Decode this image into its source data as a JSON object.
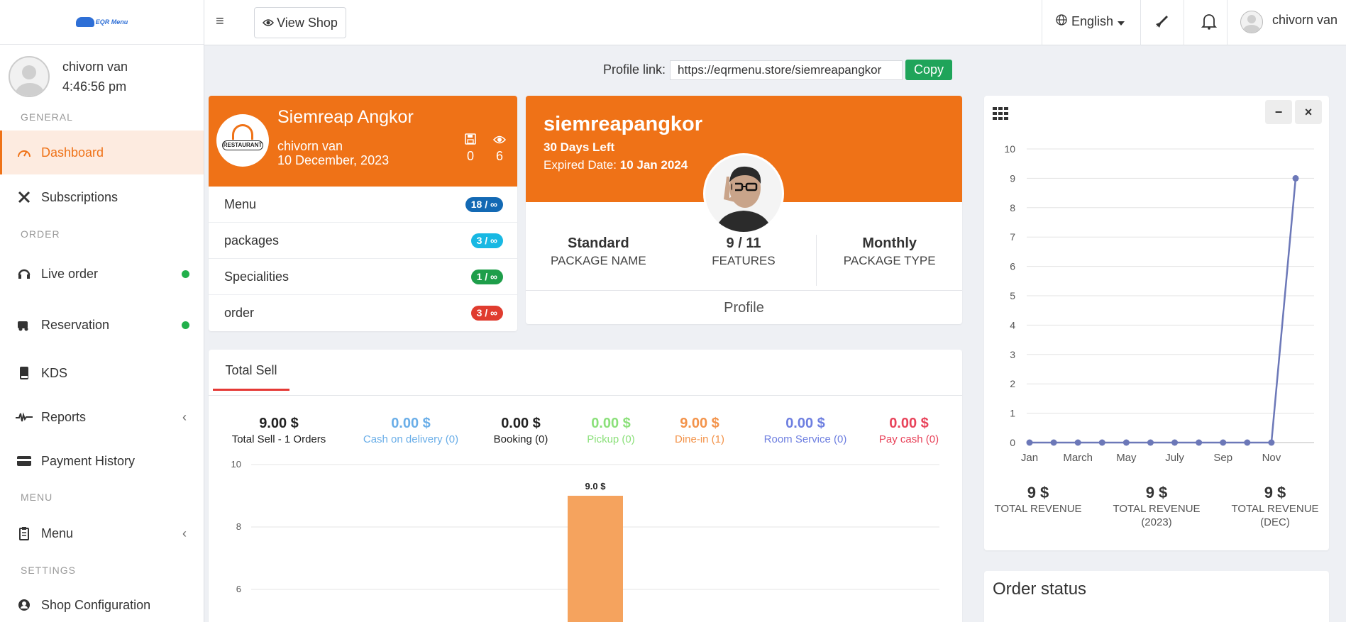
{
  "sidebar": {
    "logo_text": "EQR Menu",
    "user": {
      "name": "chivorn van",
      "time": "4:46:56 pm"
    },
    "sections": {
      "general": "GENERAL",
      "order": "ORDER",
      "menu": "MENU",
      "settings": "SETTINGS"
    },
    "items": {
      "dashboard": "Dashboard",
      "subscriptions": "Subscriptions",
      "live_order": "Live order",
      "reservation": "Reservation",
      "kds": "KDS",
      "reports": "Reports",
      "payment_history": "Payment History",
      "menu": "Menu",
      "shop_configuration": "Shop Configuration"
    },
    "status_color": "#22b04b",
    "accent": "#ef7217"
  },
  "topbar": {
    "view_shop": "View Shop",
    "language": "English",
    "username": "chivorn van"
  },
  "profile_link": {
    "label": "Profile link:",
    "url": "https://eqrmenu.store/siemreapangkor",
    "copy": "Copy"
  },
  "shop_card": {
    "name": "Siemreap Angkor",
    "logo_text": "RESTAURANT",
    "owner": "chivorn van",
    "date": "10 December, 2023",
    "saves": "0",
    "views": "6",
    "counts": [
      {
        "label": "Menu",
        "value": "18 / ∞",
        "color": "#1369b4"
      },
      {
        "label": "packages",
        "value": "3 / ∞",
        "color": "#18b8e3"
      },
      {
        "label": "Specialities",
        "value": "1 / ∞",
        "color": "#1e9e4a"
      },
      {
        "label": "order",
        "value": "3 / ∞",
        "color": "#e03c2f"
      }
    ]
  },
  "package_card": {
    "slug": "siemreapangkor",
    "days_left": "30 Days Left",
    "expired_label": "Expired Date:",
    "expired_date": "10 Jan 2024",
    "package_name": "Standard",
    "package_name_label": "PACKAGE NAME",
    "features": "9 / 11",
    "features_label": "FEATURES",
    "package_type": "Monthly",
    "package_type_label": "PACKAGE TYPE",
    "profile": "Profile"
  },
  "total_sell": {
    "tab": "Total Sell",
    "stats": [
      {
        "value": "9.00 $",
        "label": "Total Sell - 1 Orders",
        "color": "#222222"
      },
      {
        "value": "0.00 $",
        "label": "Cash on delivery (0)",
        "color": "#6aaee8"
      },
      {
        "value": "0.00 $",
        "label": "Booking (0)",
        "color": "#222222"
      },
      {
        "value": "0.00 $",
        "label": "Pickup (0)",
        "color": "#8be07a"
      },
      {
        "value": "9.00 $",
        "label": "Dine-in (1)",
        "color": "#f3934a"
      },
      {
        "value": "0.00 $",
        "label": "Room Service (0)",
        "color": "#6e7fe0"
      },
      {
        "value": "0.00 $",
        "label": "Pay cash (0)",
        "color": "#e8435a"
      }
    ]
  },
  "chart_data": [
    {
      "type": "bar",
      "title": "",
      "xlabel": "",
      "ylabel": "",
      "ylim": [
        5.5,
        10
      ],
      "y_ticks": [
        "10",
        "8",
        "6"
      ],
      "categories": [
        ""
      ],
      "values": [
        9.0
      ],
      "data_labels": [
        "9.0 $"
      ],
      "bar_color": "#f5a35e",
      "grid": true
    },
    {
      "type": "line",
      "title": "",
      "xlabel": "",
      "ylabel": "",
      "ylim": [
        0,
        10
      ],
      "y_ticks": [
        "0",
        "1",
        "2",
        "3",
        "4",
        "5",
        "6",
        "7",
        "8",
        "9",
        "10"
      ],
      "x_tick_labels": [
        "Jan",
        "March",
        "May",
        "July",
        "Sep",
        "Nov"
      ],
      "x": [
        "Jan",
        "Feb",
        "Mar",
        "Apr",
        "May",
        "Jun",
        "Jul",
        "Aug",
        "Sep",
        "Oct",
        "Nov",
        "Dec"
      ],
      "values": [
        0,
        0,
        0,
        0,
        0,
        0,
        0,
        0,
        0,
        0,
        0,
        9
      ],
      "line_color": "#6c78b8",
      "grid": true
    }
  ],
  "revenue": [
    {
      "value": "9 $",
      "label": "TOTAL REVENUE"
    },
    {
      "value": "9 $",
      "label": "TOTAL REVENUE (2023)"
    },
    {
      "value": "9 $",
      "label": "TOTAL REVENUE (DEC)"
    }
  ],
  "order_status": {
    "title": "Order status"
  }
}
